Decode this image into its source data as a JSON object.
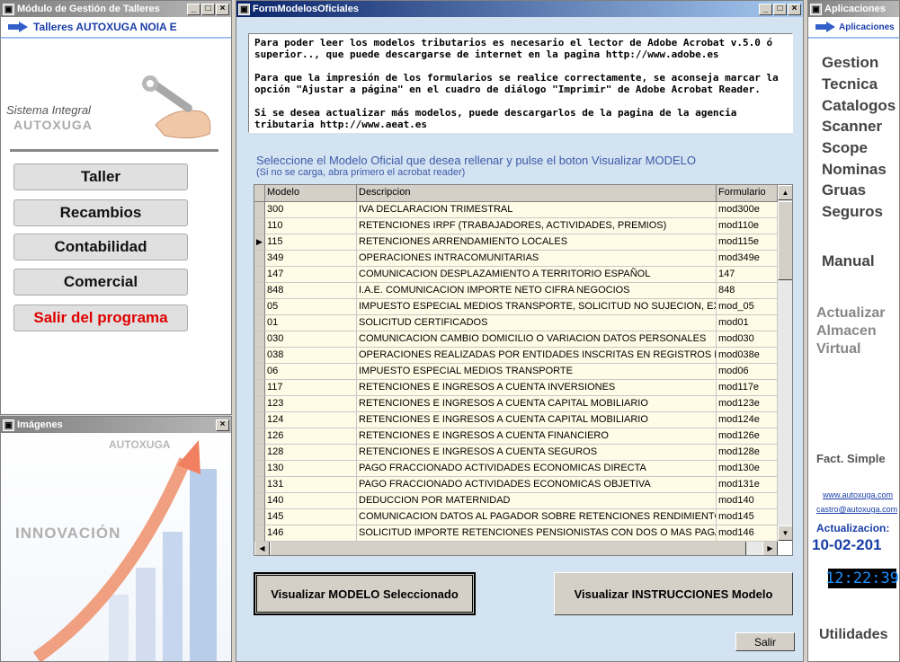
{
  "left_window": {
    "title": "Módulo de Gestión de Talleres",
    "header": "Talleres AUTOXUGA NOIA E",
    "brand_subtitle": "Sistema Integral",
    "brand_name": "AUTOXUGA",
    "menu": [
      "Taller",
      "Recambios",
      "Contabilidad",
      "Comercial",
      "Salir del programa"
    ]
  },
  "images_window": {
    "title": "Imágenes",
    "brand": "AUTOXUGA",
    "caption": "INNOVACIÓN"
  },
  "main_window": {
    "title": "FormModelosOficiales",
    "notice": [
      "Para poder leer los modelos tributarios es necesario el lector de Adobe Acrobat v.5.0 ó superior.., que puede descargarse de internet en la pagina http://www.adobe.es",
      "Para que la impresión de los formularios se realice correctamente, se aconseja marcar la opción \"Ajustar a página\" en el cuadro de diálogo \"Imprimir\" de Adobe Acrobat Reader.",
      "Si se desea actualizar más modelos, puede descargarlos de la pagina de la agencia tributaria http://www.aeat.es"
    ],
    "instruction": "Seleccione el Modelo Oficial que desea rellenar y pulse el boton Visualizar MODELO",
    "instruction_note": "(Si no se carga, abra primero el acrobat reader)",
    "grid": {
      "columns": [
        "Modelo",
        "Descripcion",
        "Formulario"
      ],
      "selected_index": 2,
      "rows": [
        [
          "300",
          "IVA DECLARACION TRIMESTRAL",
          "mod300e"
        ],
        [
          "110",
          "RETENCIONES IRPF (TRABAJADORES, ACTIVIDADES, PREMIOS)",
          "mod110e"
        ],
        [
          "115",
          "RETENCIONES ARRENDAMIENTO LOCALES",
          "mod115e"
        ],
        [
          "349",
          "OPERACIONES INTRACOMUNITARIAS",
          "mod349e"
        ],
        [
          "147",
          "COMUNICACION DESPLAZAMIENTO A TERRITORIO ESPAÑOL",
          "147"
        ],
        [
          "848",
          "I.A.E. COMUNICACION IMPORTE NETO CIFRA NEGOCIOS",
          "848"
        ],
        [
          "05",
          "IMPUESTO ESPECIAL MEDIOS TRANSPORTE, SOLICITUD NO SUJECION, EXE",
          "mod_05"
        ],
        [
          "01",
          "SOLICITUD CERTIFICADOS",
          "mod01"
        ],
        [
          "030",
          "COMUNICACION CAMBIO DOMICILIO O VARIACION DATOS PERSONALES",
          "mod030"
        ],
        [
          "038",
          "OPERACIONES REALIZADAS POR ENTIDADES INSCRITAS EN REGISTROS PU",
          "mod038e"
        ],
        [
          "06",
          "IMPUESTO ESPECIAL MEDIOS TRANSPORTE",
          "mod06"
        ],
        [
          "117",
          "RETENCIONES E INGRESOS A CUENTA INVERSIONES",
          "mod117e"
        ],
        [
          "123",
          "RETENCIONES E INGRESOS A CUENTA CAPITAL MOBILIARIO",
          "mod123e"
        ],
        [
          "124",
          "RETENCIONES E INGRESOS A CUENTA CAPITAL MOBILIARIO",
          "mod124e"
        ],
        [
          "126",
          "RETENCIONES E INGRESOS A CUENTA FINANCIERO",
          "mod126e"
        ],
        [
          "128",
          "RETENCIONES E INGRESOS A CUENTA SEGUROS",
          "mod128e"
        ],
        [
          "130",
          "PAGO FRACCIONADO ACTIVIDADES ECONOMICAS DIRECTA",
          "mod130e"
        ],
        [
          "131",
          "PAGO FRACCIONADO ACTIVIDADES ECONOMICAS OBJETIVA",
          "mod131e"
        ],
        [
          "140",
          "DEDUCCION POR MATERNIDAD",
          "mod140"
        ],
        [
          "145",
          "COMUNICACION DATOS AL PAGADOR SOBRE RETENCIONES RENDIMIENTOS",
          "mod145"
        ],
        [
          "146",
          "SOLICITUD IMPORTE RETENCIONES PENSIONISTAS CON DOS O MAS PAGAD",
          "mod146"
        ]
      ]
    },
    "btn_view_model": "Visualizar MODELO Seleccionado",
    "btn_view_instructions": "Visualizar INSTRUCCIONES Modelo",
    "btn_exit": "Salir"
  },
  "right_window": {
    "title": "Aplicaciones",
    "header": "Aplicaciones",
    "links": [
      "Gestion",
      "Tecnica",
      "Catalogos",
      "Scanner",
      "Scope",
      "Nominas",
      "Gruas",
      "Seguros"
    ],
    "manual": "Manual",
    "virtual_lines": [
      "Actualizar",
      "Almacen",
      "Virtual"
    ],
    "fact": "Fact. Simple",
    "web": "www.autoxuga.com",
    "email": "castro@autoxuga.com",
    "update_label": "Actualizacion:",
    "update_date": "10-02-201",
    "clock": "12:22:39",
    "utilities": "Utilidades"
  },
  "colors": {
    "active_title": "#0a246a",
    "accent_blue": "#3c5aa8",
    "exit_red": "#e00000"
  }
}
